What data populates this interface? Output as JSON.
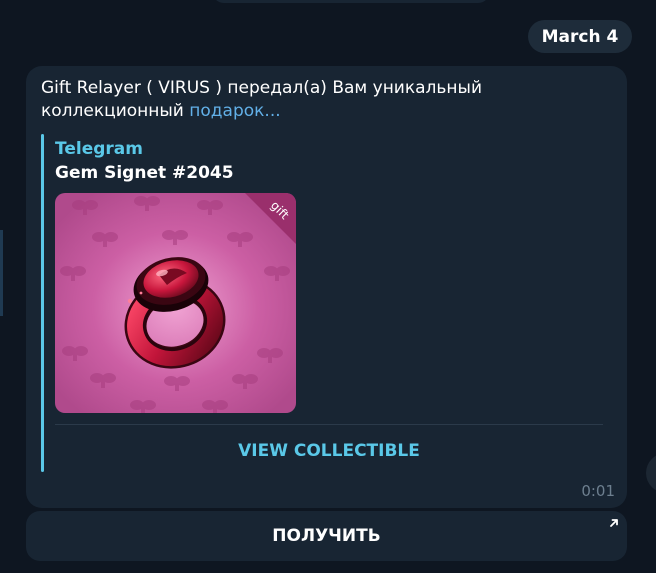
{
  "date_label": "March 4",
  "message": {
    "text": "Gift Relayer ( VIRUS ) передал(а) Вам уникальный коллекционный",
    "link": "подарок...",
    "time": "0:01"
  },
  "preview": {
    "site_name": "Telegram",
    "title": "Gem Signet #2045",
    "ribbon": "gift",
    "view_button": "VIEW COLLECTIBLE"
  },
  "inline_button": {
    "label": "ПОЛУЧИТЬ",
    "icon": "arrow-up-right-icon"
  },
  "colors": {
    "background": "#0e1621",
    "bubble": "#182533",
    "accent": "#5ac8e8",
    "link": "#62b0e8",
    "gift_background": "#c2559a",
    "ring_red": "#c21a3c"
  }
}
